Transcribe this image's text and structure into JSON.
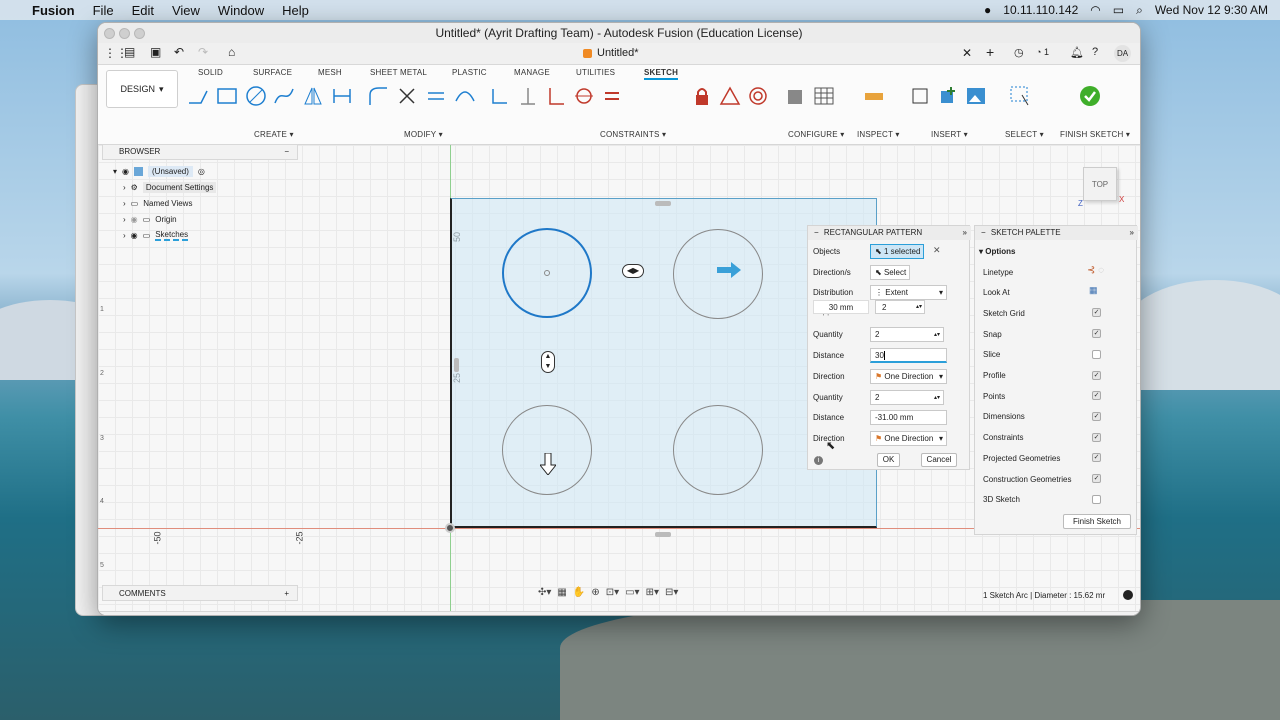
{
  "menubar": {
    "app_name": "Fusion",
    "menus": [
      "File",
      "Edit",
      "View",
      "Window",
      "Help"
    ],
    "ip": "10.11.110.142",
    "datetime": "Wed Nov 12  9:30 AM"
  },
  "window": {
    "title": "Untitled* (Ayrit Drafting Team) - Autodesk Fusion (Education License)",
    "doc_tab": "Untitled*",
    "notif_count": "1",
    "avatar": "DA"
  },
  "ribbon": {
    "workspace": "DESIGN",
    "tabs": [
      "SOLID",
      "SURFACE",
      "MESH",
      "SHEET METAL",
      "PLASTIC",
      "MANAGE",
      "UTILITIES",
      "SKETCH"
    ],
    "active_tab": "SKETCH",
    "groups": [
      "CREATE",
      "MODIFY",
      "CONSTRAINTS",
      "CONFIGURE",
      "INSPECT",
      "INSERT",
      "SELECT",
      "FINISH SKETCH"
    ]
  },
  "browser": {
    "title": "BROWSER",
    "items": [
      "(Unsaved)",
      "Document Settings",
      "Named Views",
      "Origin",
      "Sketches"
    ]
  },
  "canvas": {
    "ruler_v": [
      "50",
      "25"
    ],
    "ruler_h": [
      "-50",
      "-25"
    ],
    "left_ticks": [
      "1",
      "2",
      "3",
      "4",
      "5"
    ],
    "viewcube": "TOP",
    "axis_x": "X",
    "axis_z": "Z"
  },
  "pattern": {
    "title": "RECTANGULAR PATTERN",
    "objects_label": "Objects",
    "objects_value": "1 selected",
    "direction_label": "Direction/s",
    "direction_value": "Select",
    "distribution_label": "Distribution",
    "distribution_value": "Extent",
    "suppression_label": "Suppression",
    "overlay_distance": "30 mm",
    "overlay_quantity": "2",
    "quantity_label": "Quantity",
    "quantity1": "2",
    "distance_label": "Distance",
    "distance1": "30",
    "direction_row_label": "Direction",
    "direction1": "One Direction",
    "quantity2": "2",
    "distance2": "-31.00 mm",
    "direction2": "One Direction",
    "ok": "OK",
    "cancel": "Cancel"
  },
  "palette": {
    "title": "SKETCH PALETTE",
    "section": "Options",
    "rows": [
      {
        "label": "Linetype",
        "mark": ""
      },
      {
        "label": "Look At",
        "mark": ""
      },
      {
        "label": "Sketch Grid",
        "mark": "✓"
      },
      {
        "label": "Snap",
        "mark": "✓"
      },
      {
        "label": "Slice",
        "mark": ""
      },
      {
        "label": "Profile",
        "mark": "✓"
      },
      {
        "label": "Points",
        "mark": "✓"
      },
      {
        "label": "Dimensions",
        "mark": "✓"
      },
      {
        "label": "Constraints",
        "mark": "✓"
      },
      {
        "label": "Projected Geometries",
        "mark": "✓"
      },
      {
        "label": "Construction Geometries",
        "mark": "✓"
      },
      {
        "label": "3D Sketch",
        "mark": ""
      }
    ],
    "finish_button": "Finish Sketch"
  },
  "comments": {
    "label": "COMMENTS"
  },
  "status": {
    "text": "1 Sketch Arc | Diameter : 15.62 mr"
  },
  "colors": {
    "accent": "#0696d7",
    "selected_circle": "#1f78c8",
    "finish_green": "#3fae2a"
  }
}
